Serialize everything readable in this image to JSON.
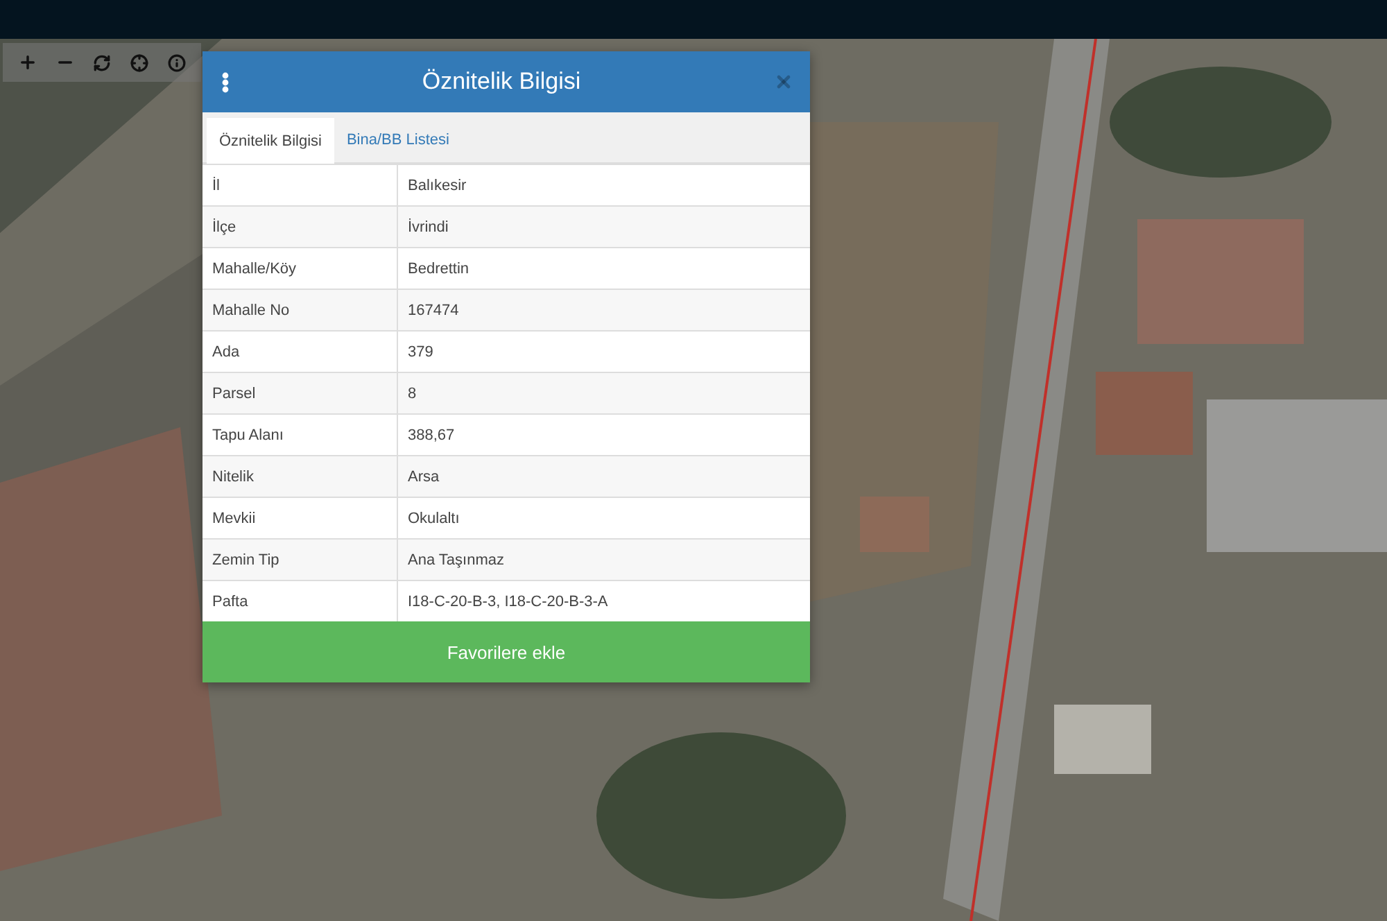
{
  "dialog": {
    "title": "Öznitelik Bilgisi",
    "tabs": [
      {
        "label": "Öznitelik Bilgisi",
        "selected": true
      },
      {
        "label": "Bina/BB Listesi",
        "selected": false
      }
    ],
    "rows": [
      {
        "label": "İl",
        "value": "Balıkesir"
      },
      {
        "label": "İlçe",
        "value": "İvrindi"
      },
      {
        "label": "Mahalle/Köy",
        "value": "Bedrettin"
      },
      {
        "label": "Mahalle No",
        "value": "167474"
      },
      {
        "label": "Ada",
        "value": "379"
      },
      {
        "label": "Parsel",
        "value": "8"
      },
      {
        "label": "Tapu Alanı",
        "value": "388,67"
      },
      {
        "label": "Nitelik",
        "value": "Arsa"
      },
      {
        "label": "Mevkii",
        "value": "Okulaltı"
      },
      {
        "label": "Zemin Tip",
        "value": "Ana Taşınmaz"
      },
      {
        "label": "Pafta",
        "value": "I18-C-20-B-3, I18-C-20-B-3-A"
      }
    ],
    "button": "Favorilere ekle"
  }
}
